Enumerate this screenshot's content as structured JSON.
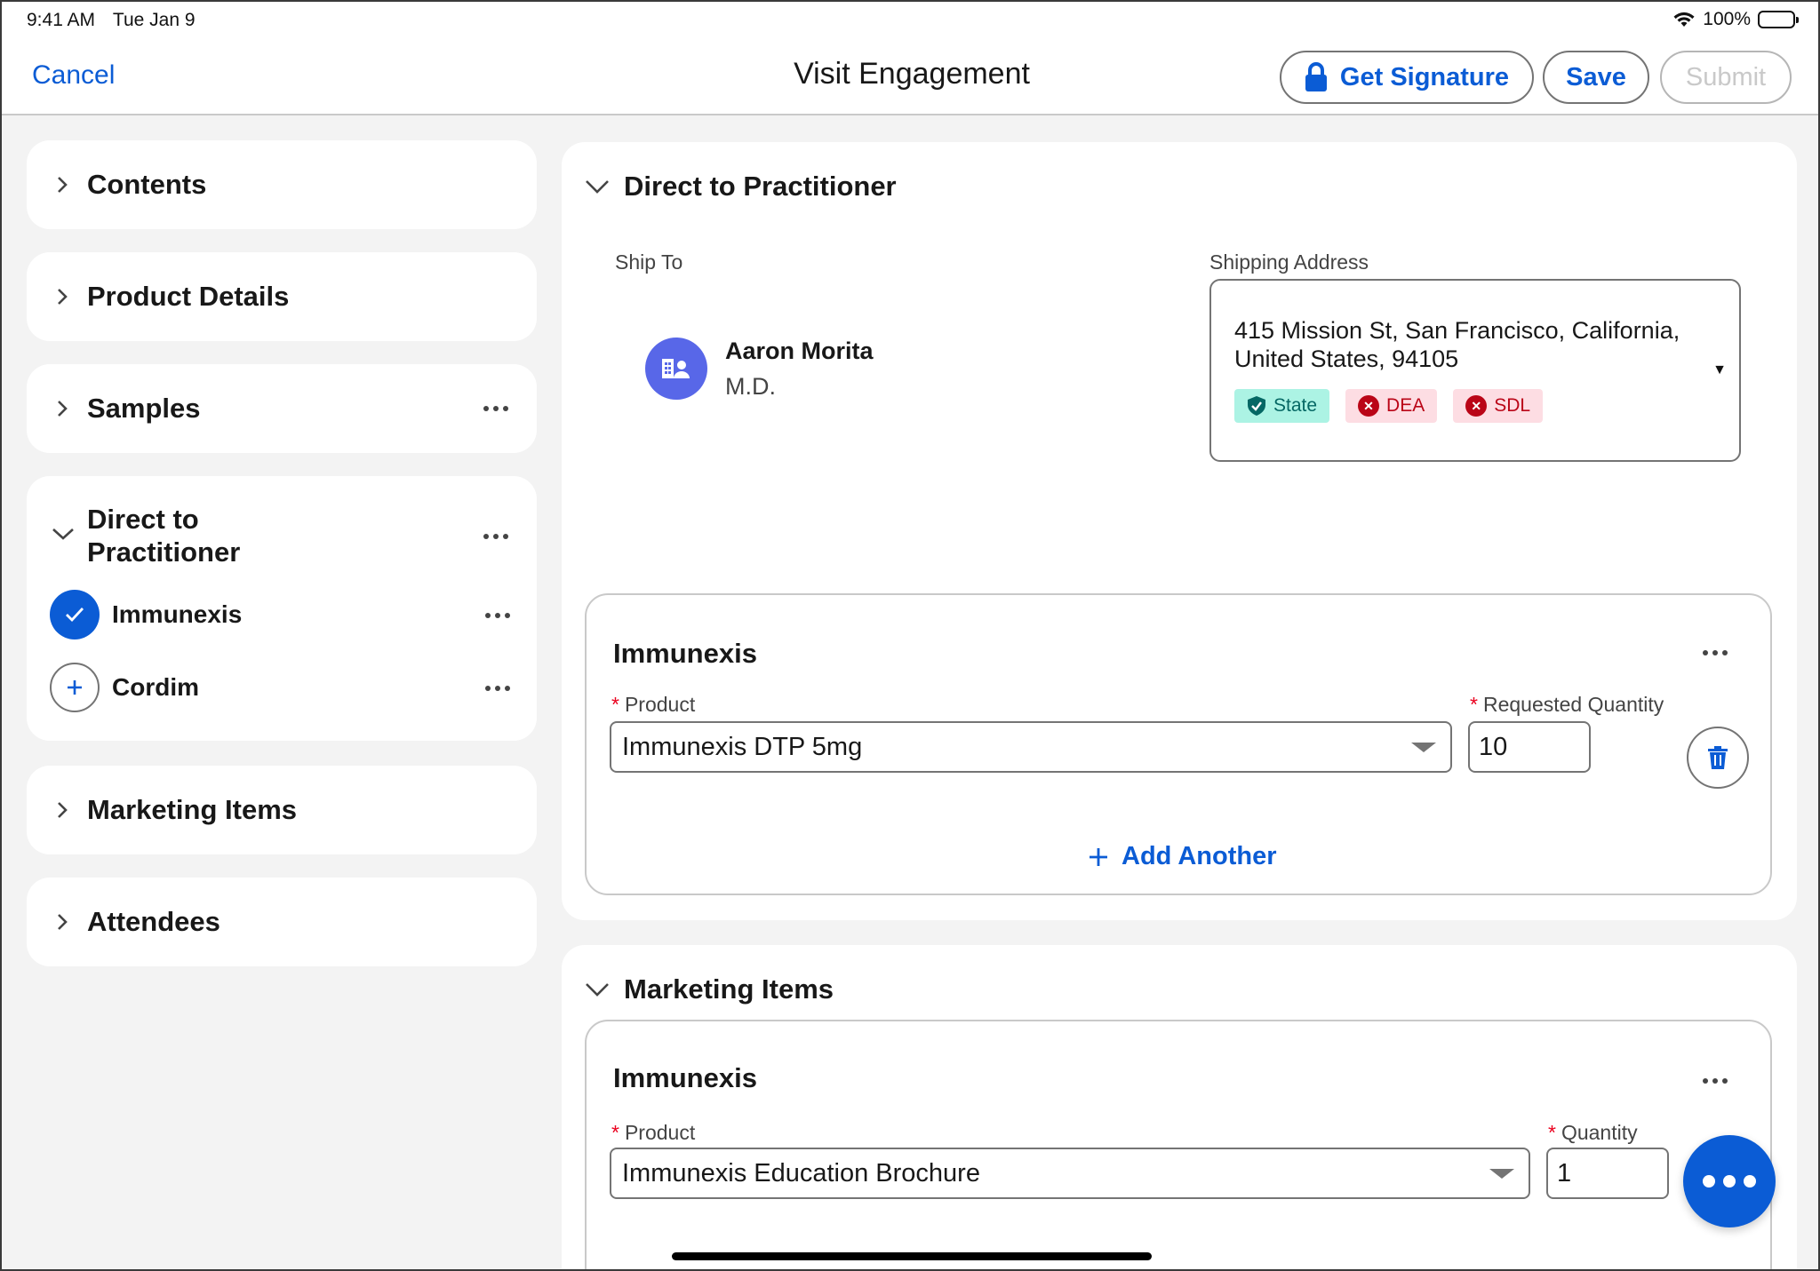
{
  "status_bar": {
    "time": "9:41 AM",
    "date": "Tue Jan 9",
    "battery": "100%"
  },
  "header": {
    "cancel_label": "Cancel",
    "title": "Visit Engagement",
    "get_signature_label": "Get Signature",
    "save_label": "Save",
    "submit_label": "Submit"
  },
  "sidebar": {
    "contents": "Contents",
    "product_details": "Product Details",
    "samples": "Samples",
    "dtp": "Direct to Practitioner",
    "dtp_items": [
      {
        "label": "Immunexis",
        "state": "checked"
      },
      {
        "label": "Cordim",
        "state": "add"
      }
    ],
    "marketing_items": "Marketing Items",
    "attendees": "Attendees"
  },
  "dtp_section": {
    "title": "Direct to Practitioner",
    "ship_to_label": "Ship To",
    "recipient_name": "Aaron Morita",
    "recipient_credential": "M.D.",
    "shipping_address_label": "Shipping Address",
    "shipping_address": "415 Mission St, San Francisco, California, United States, 94105",
    "badges": [
      {
        "label": "State",
        "icon": "shield-check-icon"
      },
      {
        "label": "DEA",
        "icon": "error-icon"
      },
      {
        "label": "SDL",
        "icon": "error-icon"
      }
    ],
    "product_card": {
      "title": "Immunexis",
      "product_label": "Product",
      "product_value": "Immunexis DTP 5mg",
      "quantity_label": "Requested Quantity",
      "quantity_value": "10",
      "add_another_label": "Add Another"
    }
  },
  "marketing_section": {
    "title": "Marketing Items",
    "product_card": {
      "title": "Immunexis",
      "product_label": "Product",
      "product_value": "Immunexis Education Brochure",
      "quantity_label": "Quantity",
      "quantity_value": "1"
    }
  },
  "colors": {
    "brand": "#0b5cd5",
    "required": "#ea001e",
    "avatar": "#5867e8"
  }
}
